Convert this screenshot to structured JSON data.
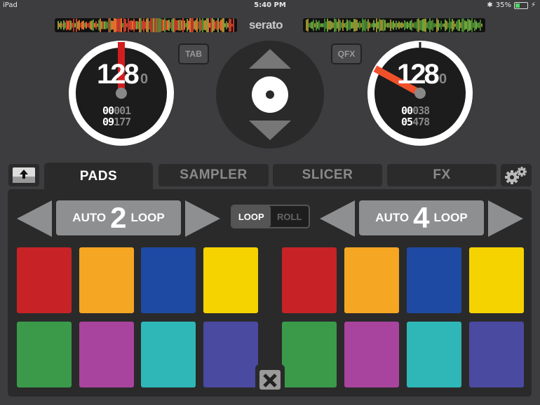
{
  "status_bar": {
    "device": "iPad",
    "time": "5:40 PM",
    "battery": "35%"
  },
  "app": {
    "logo": "serato"
  },
  "deck_left": {
    "bpm": "128",
    "bpm_fraction": "0",
    "elapsed_white": "00",
    "elapsed_gray": "001",
    "remaining_white": "09",
    "remaining_gray": "177"
  },
  "deck_right": {
    "bpm": "128",
    "bpm_fraction": "0",
    "elapsed_white": "00",
    "elapsed_gray": "038",
    "remaining_white": "05",
    "remaining_gray": "478"
  },
  "buttons": {
    "tab": "TAB",
    "qfx": "QFX"
  },
  "tabs": [
    {
      "label": "PADS"
    },
    {
      "label": "SAMPLER"
    },
    {
      "label": "SLICER"
    },
    {
      "label": "FX"
    }
  ],
  "loop_left": {
    "prefix": "AUTO",
    "value": "2",
    "suffix": "LOOP"
  },
  "loop_right": {
    "prefix": "AUTO",
    "value": "4",
    "suffix": "LOOP"
  },
  "loop_toggle": {
    "loop": "LOOP",
    "roll": "ROLL"
  },
  "colors": {
    "pads_left": [
      "#c72326",
      "#f5a623",
      "#1f4aa3",
      "#f5d300",
      "#3a9a4a",
      "#a8449e",
      "#2fb7b7",
      "#4a4aa0"
    ],
    "pads_right": [
      "#c72326",
      "#f5a623",
      "#1f4aa3",
      "#f5d300",
      "#3a9a4a",
      "#a8449e",
      "#2fb7b7",
      "#4a4aa0"
    ],
    "needle_left": "#d21e1e",
    "needle_right": "#f0502a",
    "battery_fill": "#4cd964"
  },
  "deck_left_needle_fraction": 0.0,
  "deck_right_needle_fraction": 0.83
}
